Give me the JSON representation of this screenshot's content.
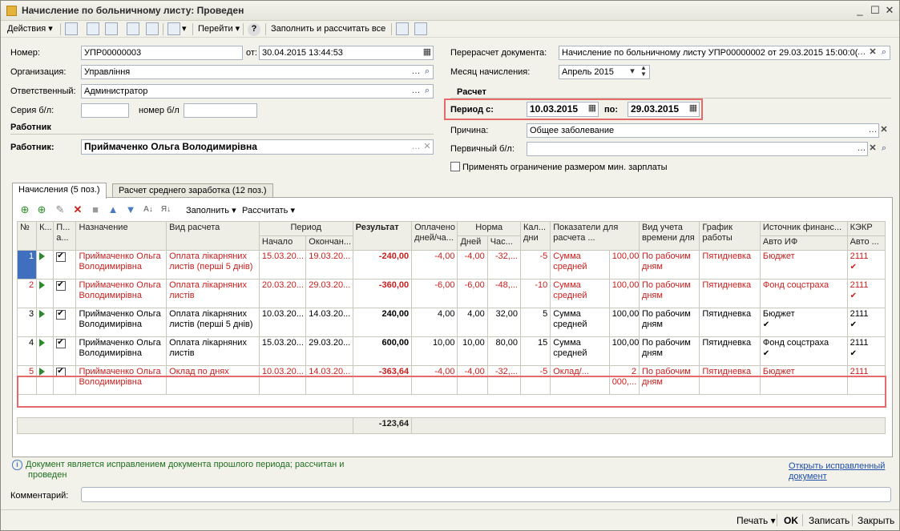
{
  "window": {
    "title": "Начисление по больничному листу: Проведен"
  },
  "toolbar": {
    "actions": "Действия",
    "goto": "Перейти",
    "fill_calc": "Заполнить и рассчитать все"
  },
  "form": {
    "number_label": "Номер:",
    "number": "УПР00000003",
    "from_label": "от:",
    "date": "30.04.2015 13:44:53",
    "org_label": "Организация:",
    "org": "Управління",
    "resp_label": "Ответственный:",
    "resp": "Администратор",
    "series_label": "Серия б/л:",
    "series": "",
    "number_bl_label": "номер б/л",
    "number_bl": "",
    "worker_section": "Работник",
    "worker_label": "Работник:",
    "worker": "Приймаченко Ольга Володимирівна",
    "recalc_label": "Перерасчет документа:",
    "recalc": "Начисление по больничному листу УПР00000002 от 29.03.2015 15:00:0(",
    "month_label": "Месяц начисления:",
    "month": "Апрель 2015",
    "calc_section": "Расчет",
    "period_from_label": "Период с:",
    "period_from": "10.03.2015",
    "period_to_label": "по:",
    "period_to": "29.03.2015",
    "reason_label": "Причина:",
    "reason": "Общее заболевание",
    "primary_label": "Первичный б/л:",
    "primary": "",
    "min_salary_label": "Применять ограничение размером мин. зарплаты"
  },
  "tabs": [
    "Начисления (5 поз.)",
    "Расчет среднего заработка (12 поз.)"
  ],
  "grid_toolbar": {
    "fill": "Заполнить",
    "calc": "Рассчитать"
  },
  "grid": {
    "headers": {
      "n": "№",
      "k": "К...",
      "p": "П...",
      "p2": "а...",
      "purpose": "Назначение",
      "calc_type": "Вид расчета",
      "period": "Период",
      "start": "Начало",
      "end": "Окончан...",
      "result": "Результат",
      "paid": "Оплачено дней/ча...",
      "norm": "Норма",
      "days": "Дней",
      "hours": "Час...",
      "cal": "Кал... дни",
      "indicators": "Показатели для расчета ...",
      "time_type": "Вид учета времени для",
      "schedule": "График работы",
      "source": "Источник финанс...",
      "source_sub": "Авто ИФ",
      "kekr": "КЭКР",
      "kekr_sub": "Авто ..."
    },
    "rows": [
      {
        "n": "1",
        "purpose": "Приймаченко Ольга Володимирівна",
        "calc_type": "Оплата лікарняних листів (перші 5 днів)",
        "start": "15.03.20...",
        "end": "19.03.20...",
        "result": "-240,00",
        "paid": "-4,00",
        "days": "-4,00",
        "hours": "-32,...",
        "cal": "-5",
        "ind_name": "Сумма средней",
        "ind_val": "100,000",
        "time_type": "По рабочим дням",
        "schedule": "Пятидневка",
        "source": "Бюджет",
        "kekr": "2111"
      },
      {
        "n": "2",
        "purpose": "Приймаченко Ольга Володимирівна",
        "calc_type": "Оплата лікарняних листів",
        "start": "20.03.20...",
        "end": "29.03.20...",
        "result": "-360,00",
        "paid": "-6,00",
        "days": "-6,00",
        "hours": "-48,...",
        "cal": "-10",
        "ind_name": "Сумма средней",
        "ind_val": "100,000",
        "time_type": "По рабочим дням",
        "schedule": "Пятидневка",
        "source": "Фонд соцстраха",
        "kekr": "2111"
      },
      {
        "n": "3",
        "purpose": "Приймаченко Ольга Володимирівна",
        "calc_type": "Оплата лікарняних листів (перші 5 днів)",
        "start": "10.03.20...",
        "end": "14.03.20...",
        "result": "240,00",
        "paid": "4,00",
        "days": "4,00",
        "hours": "32,00",
        "cal": "5",
        "ind_name": "Сумма средней",
        "ind_val": "100,000",
        "time_type": "По рабочим дням",
        "schedule": "Пятидневка",
        "source": "Бюджет",
        "kekr": "2111"
      },
      {
        "n": "4",
        "purpose": "Приймаченко Ольга Володимирівна",
        "calc_type": "Оплата лікарняних листів",
        "start": "15.03.20...",
        "end": "29.03.20...",
        "result": "600,00",
        "paid": "10,00",
        "days": "10,00",
        "hours": "80,00",
        "cal": "15",
        "ind_name": "Сумма средней",
        "ind_val": "100,000",
        "time_type": "По рабочим дням",
        "schedule": "Пятидневка",
        "source": "Фонд соцстраха",
        "kekr": "2111"
      },
      {
        "n": "5",
        "purpose": "Приймаченко Ольга Володимирівна",
        "calc_type": "Оклад по днях",
        "start": "10.03.20...",
        "end": "14.03.20...",
        "result": "-363,64",
        "paid": "-4,00",
        "days": "-4,00",
        "hours": "-32,...",
        "cal": "-5",
        "ind_name": "Оклад/...",
        "ind_val": "2 000,...",
        "time_type": "По рабочим дням",
        "schedule": "Пятидневка",
        "source": "Бюджет",
        "kekr": "2111"
      }
    ],
    "total": "-123,64"
  },
  "info": {
    "line1": "Документ является исправлением документа прошлого периода; рассчитан и",
    "line2": "проведен"
  },
  "link": {
    "line1": "Открыть исправленный",
    "line2": "документ"
  },
  "comment_label": "Комментарий:",
  "comment": "",
  "bottom": {
    "print": "Печать",
    "ok": "OK",
    "save": "Записать",
    "close": "Закрыть"
  }
}
